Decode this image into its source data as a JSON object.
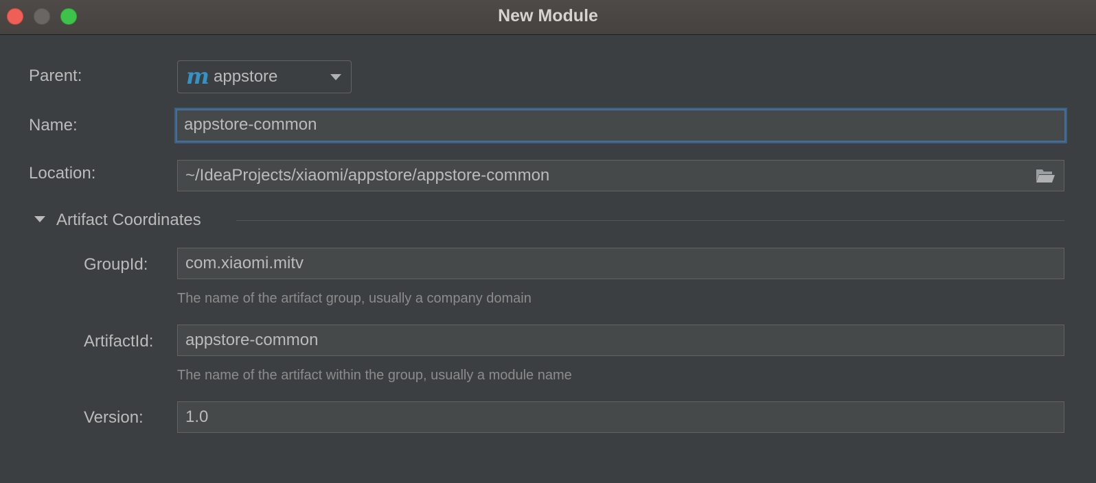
{
  "window": {
    "title": "New Module"
  },
  "form": {
    "parent_label": "Parent:",
    "parent_value": "appstore",
    "parent_icon_letter": "m",
    "name_label": "Name:",
    "name_value": "appstore-common",
    "location_label": "Location:",
    "location_value": "~/IdeaProjects/xiaomi/appstore/appstore-common"
  },
  "artifact": {
    "section_title": "Artifact Coordinates",
    "group_label": "GroupId:",
    "group_value": "com.xiaomi.mitv",
    "group_hint": "The name of the artifact group, usually a company domain",
    "artifact_label": "ArtifactId:",
    "artifact_value": "appstore-common",
    "artifact_hint": "The name of the artifact within the group, usually a module name",
    "version_label": "Version:",
    "version_value": "1.0"
  },
  "icons": {
    "parent": "maven-module-icon",
    "dropdown": "chevron-down-icon",
    "location": "folder-open-icon",
    "section": "collapse-triangle-icon"
  },
  "colors": {
    "focus_border": "#466d94",
    "maven_icon": "#3592c4",
    "close": "#ee5f57",
    "zoom": "#3dc34a"
  }
}
